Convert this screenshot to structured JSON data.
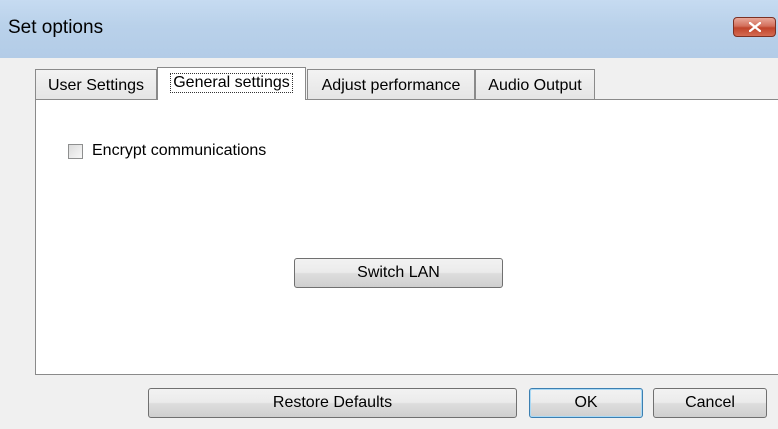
{
  "window": {
    "title": "Set options",
    "close_icon": "close-icon"
  },
  "tabs": [
    {
      "label": "User Settings",
      "active": false
    },
    {
      "label": "General settings",
      "active": true
    },
    {
      "label": "Adjust performance",
      "active": false
    },
    {
      "label": "Audio Output",
      "active": false
    }
  ],
  "general": {
    "encrypt_label": "Encrypt communications",
    "encrypt_checked": false,
    "switch_lan_label": "Switch LAN"
  },
  "footer": {
    "restore_label": "Restore Defaults",
    "ok_label": "OK",
    "cancel_label": "Cancel"
  },
  "colors": {
    "titlebar": "#b9d1ea",
    "close_button": "#c0442b",
    "dialog_bg": "#f0f0f0",
    "panel_bg": "#ffffff"
  }
}
